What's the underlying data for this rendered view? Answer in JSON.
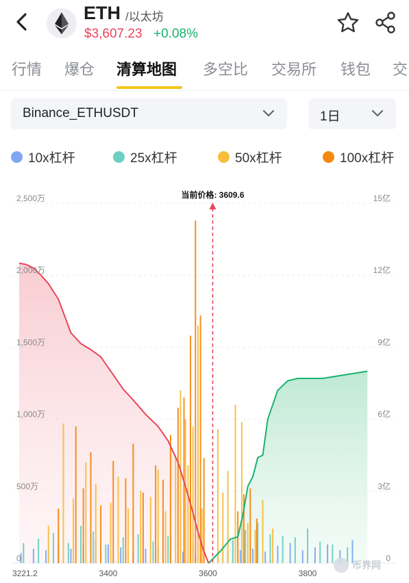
{
  "header": {
    "symbol": "ETH",
    "alias": "/以太坊",
    "price": "$3,607.23",
    "change": "+0.08%",
    "colors": {
      "up": "#18b26e",
      "down": "#e9445a"
    }
  },
  "icons": {
    "back": "back-arrow-icon",
    "logo": "ethereum-logo-icon",
    "favorite": "star-icon",
    "share": "share-icon",
    "dropdown": "chevron-down-icon"
  },
  "tabs": [
    {
      "label": "行情"
    },
    {
      "label": "爆仓"
    },
    {
      "label": "清算地图",
      "active": true
    },
    {
      "label": "多空比"
    },
    {
      "label": "交易所"
    },
    {
      "label": "钱包"
    },
    {
      "label": "交"
    }
  ],
  "selectors": {
    "pair": "Binance_ETHUSDT",
    "period": "1日"
  },
  "legend": [
    {
      "label": "10x杠杆",
      "color": "#7ea6f4"
    },
    {
      "label": "25x杠杆",
      "color": "#6ccfc2"
    },
    {
      "label": "50x杠杆",
      "color": "#f9bd3d"
    },
    {
      "label": "100x杠杆",
      "color": "#f5870f"
    }
  ],
  "watermark": "币界网",
  "chart_data": {
    "type": "bar",
    "current_price_label": "当前价格: 3609.6",
    "current_price": 3609.6,
    "xlim": [
      3221.2,
      3601.4
    ],
    "x_ticks": [
      "3221.2",
      "3400",
      "3600",
      "3800"
    ],
    "x_tick_values": [
      3221.2,
      3400,
      3600,
      3800
    ],
    "left_axis": {
      "ylim": [
        0,
        25000000
      ],
      "ticks": [
        "0",
        "500万",
        "1,000万",
        "1,500万",
        "2,000万",
        "2,500万"
      ]
    },
    "right_axis": {
      "ylim": [
        0,
        1500000000
      ],
      "ticks": [
        "0",
        "3亿",
        "6亿",
        "9亿",
        "12亿",
        "15亿"
      ]
    },
    "series": [
      {
        "name": "10x杠杆",
        "color": "#7ea6f4",
        "x": [
          3225,
          3250,
          3275,
          3300,
          3325,
          3350,
          3375,
          3400,
          3425,
          3450,
          3475,
          3500,
          3525,
          3550,
          3575,
          3640,
          3665,
          3690,
          3715,
          3740,
          3765,
          3790,
          3815,
          3840,
          3865,
          3890
        ],
        "values": [
          700000,
          1000000,
          900000,
          1300000,
          1000000,
          1200000,
          1600000,
          1300000,
          1100000,
          900000,
          1000000,
          1200000,
          900000,
          800000,
          600000,
          800000,
          900000,
          1000000,
          800000,
          1200000,
          1400000,
          900000,
          1100000,
          1300000,
          900000,
          1600000
        ]
      },
      {
        "name": "25x杠杆",
        "color": "#6ccfc2",
        "x": [
          3230,
          3260,
          3290,
          3320,
          3345,
          3370,
          3395,
          3430,
          3460,
          3490,
          3520,
          3545,
          3570,
          3650,
          3675,
          3700,
          3725,
          3750,
          3775,
          3800,
          3825,
          3850,
          3880
        ],
        "values": [
          1400000,
          1700000,
          2100000,
          1400000,
          2600000,
          2200000,
          1300000,
          1800000,
          2000000,
          1500000,
          1900000,
          2400000,
          1200000,
          1600000,
          2300000,
          2800000,
          2000000,
          1900000,
          1800000,
          2400000,
          1500000,
          1300000,
          1100000
        ]
      },
      {
        "name": "50x杠杆",
        "color": "#f9bd3d",
        "x": [
          3280,
          3310,
          3330,
          3355,
          3375,
          3405,
          3420,
          3440,
          3465,
          3485,
          3500,
          3515,
          3535,
          3545,
          3555,
          3560,
          3570,
          3580,
          3588,
          3620,
          3630,
          3640,
          3655,
          3668,
          3680,
          3695,
          3710,
          3730
        ],
        "values": [
          2600000,
          9700000,
          4500000,
          7000000,
          5500000,
          4200000,
          6000000,
          3800000,
          5000000,
          4600000,
          6500000,
          3600000,
          7500000,
          12000000,
          10000000,
          6800000,
          9500000,
          16500000,
          3800000,
          9300000,
          4900000,
          6400000,
          11000000,
          9800000,
          2800000,
          2300000,
          4400000,
          2400000
        ]
      },
      {
        "name": "100x杠杆",
        "color": "#f5870f",
        "x": [
          3300,
          3335,
          3350,
          3365,
          3385,
          3410,
          3435,
          3450,
          3470,
          3495,
          3510,
          3525,
          3540,
          3552,
          3565,
          3575,
          3585,
          3592,
          3660,
          3672,
          3685,
          3698
        ],
        "values": [
          3800000,
          9500000,
          5200000,
          7700000,
          4000000,
          7100000,
          5900000,
          8300000,
          4900000,
          6800000,
          5800000,
          8900000,
          10800000,
          11500000,
          15800000,
          23800000,
          17200000,
          7300000,
          3600000,
          4800000,
          5200000,
          3100000
        ]
      },
      {
        "name": "cumulative_short",
        "color": "#e9445a",
        "axis": "right",
        "x": [
          3221.2,
          3235,
          3250,
          3265,
          3280,
          3300,
          3325,
          3345,
          3365,
          3385,
          3405,
          3430,
          3450,
          3475,
          3500,
          3520,
          3540,
          3555,
          3570,
          3580,
          3590,
          3601.4
        ],
        "values": [
          1250000000,
          1245000000,
          1230000000,
          1200000000,
          1165000000,
          1100000000,
          960000000,
          915000000,
          890000000,
          860000000,
          800000000,
          725000000,
          680000000,
          620000000,
          570000000,
          510000000,
          420000000,
          320000000,
          210000000,
          130000000,
          60000000,
          0
        ]
      },
      {
        "name": "cumulative_long",
        "color": "#18b26e",
        "axis": "right",
        "x": [
          3601.4,
          3625,
          3645,
          3660,
          3670,
          3680,
          3690,
          3700,
          3710,
          3720,
          3740,
          3760,
          3780,
          3800,
          3830,
          3860,
          3890,
          3920
        ],
        "values": [
          0,
          50000000,
          100000000,
          110000000,
          200000000,
          320000000,
          360000000,
          440000000,
          450000000,
          600000000,
          720000000,
          760000000,
          770000000,
          770000000,
          770000000,
          780000000,
          790000000,
          800000000
        ]
      }
    ]
  }
}
